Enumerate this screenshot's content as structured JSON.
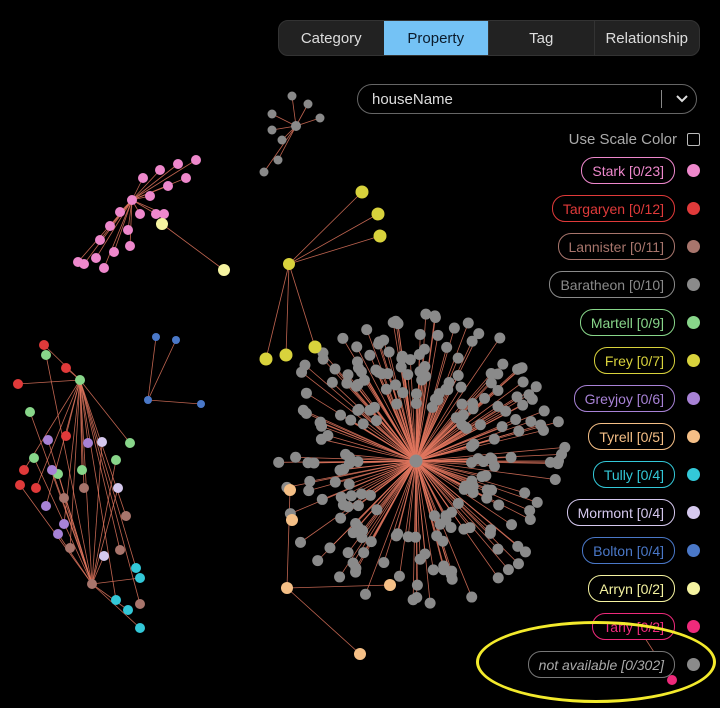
{
  "tabs": [
    {
      "label": "Category",
      "active": false
    },
    {
      "label": "Property",
      "active": true
    },
    {
      "label": "Tag",
      "active": false
    },
    {
      "label": "Relationship",
      "active": false
    }
  ],
  "property_select": {
    "value": "houseName",
    "icon": "chevron-down-icon"
  },
  "scale_toggle": {
    "label": "Use Scale Color",
    "checked": false
  },
  "legend": [
    {
      "label": "Stark [0/23]",
      "color": "#ee88cc"
    },
    {
      "label": "Targaryen [0/12]",
      "color": "#e03a3a"
    },
    {
      "label": "Lannister [0/11]",
      "color": "#a8756c"
    },
    {
      "label": "Baratheon [0/10]",
      "color": "#8a8a8a"
    },
    {
      "label": "Martell [0/9]",
      "color": "#88d68a"
    },
    {
      "label": "Frey [0/7]",
      "color": "#d8d23c"
    },
    {
      "label": "Greyjoy [0/6]",
      "color": "#a882d6"
    },
    {
      "label": "Tyrell [0/5]",
      "color": "#f5bf86"
    },
    {
      "label": "Tully [0/4]",
      "color": "#33c8d8"
    },
    {
      "label": "Mormont [0/4]",
      "color": "#d5c8ee"
    },
    {
      "label": "Bolton [0/4]",
      "color": "#4a78c8"
    },
    {
      "label": "Arryn [0/2]",
      "color": "#f5f3a0"
    },
    {
      "label": "Tarly [0/2]",
      "color": "#ee2a7b"
    },
    {
      "label": "not available [0/302]",
      "color": "#8a8a8a",
      "italic": true
    }
  ],
  "colors": {
    "edge": "#e0765e",
    "tab_active": "#74c2f5",
    "highlight": "#f3ea2c"
  }
}
